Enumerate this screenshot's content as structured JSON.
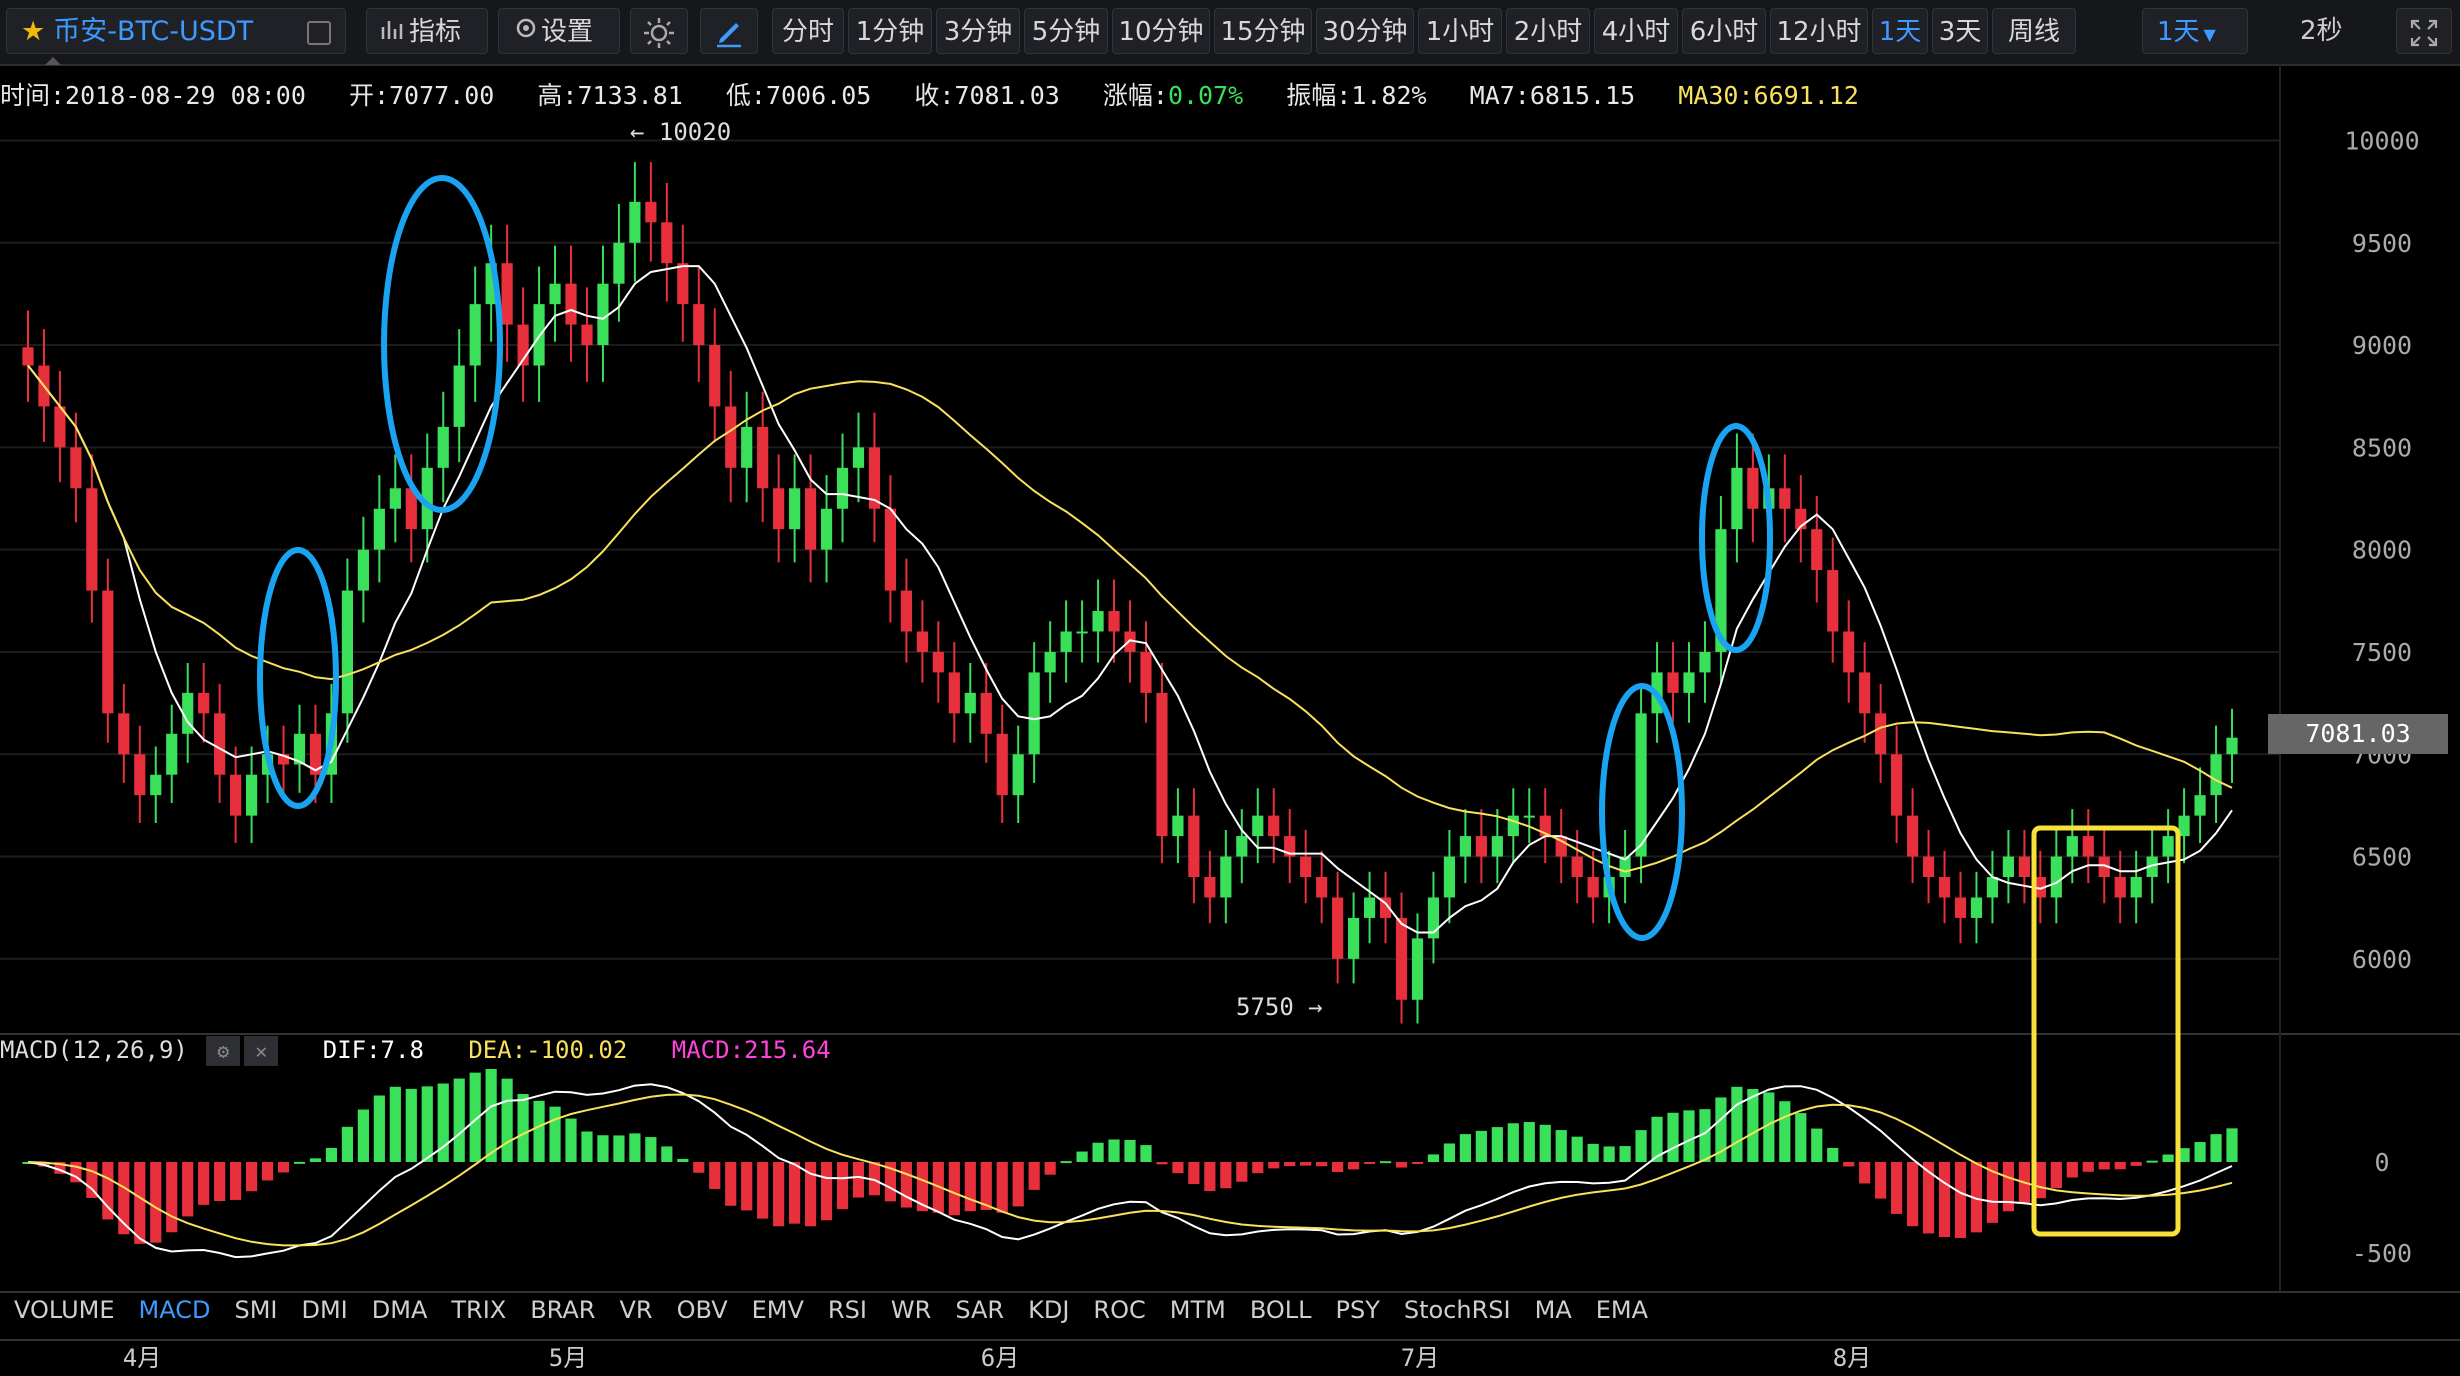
{
  "toolbar": {
    "symbol": "币安-BTC-USDT",
    "indicators": "指标",
    "settings": "设置",
    "intervals": [
      "分时",
      "1分钟",
      "3分钟",
      "5分钟",
      "10分钟",
      "15分钟",
      "30分钟",
      "1小时",
      "2小时",
      "4小时",
      "6小时",
      "12小时",
      "1天",
      "3天",
      "周线"
    ],
    "active_interval": "1天",
    "interval_dropdown": "1天",
    "refresh": "2秒"
  },
  "info": {
    "time": "时间:2018-08-29 08:00",
    "open": "开:7077.00",
    "high": "高:7133.81",
    "low": "低:7006.05",
    "close": "收:7081.03",
    "change_label": "涨幅:",
    "change_value": "0.07%",
    "amplitude": "振幅:1.82%",
    "ma7": "MA7:6815.15",
    "ma30": "MA30:6691.12"
  },
  "price_axis": {
    "ticks": [
      "10000",
      "9500",
      "9000",
      "8500",
      "8000",
      "7500",
      "7000",
      "6500",
      "6000"
    ],
    "current": "7081.03"
  },
  "annotations": {
    "high": "10020",
    "low": "5750"
  },
  "macd": {
    "title": "MACD(12,26,9)",
    "dif": "DIF:7.8",
    "dea": "DEA:-100.02",
    "macd": "MACD:215.64",
    "ticks": [
      "0",
      "-500"
    ]
  },
  "x_axis": {
    "labels": [
      "4月",
      "5月",
      "6月",
      "7月",
      "8月"
    ]
  },
  "indicator_tabs": [
    "VOLUME",
    "MACD",
    "SMI",
    "DMI",
    "DMA",
    "TRIX",
    "BRAR",
    "VR",
    "OBV",
    "EMV",
    "RSI",
    "WR",
    "SAR",
    "KDJ",
    "ROC",
    "MTM",
    "BOLL",
    "PSY",
    "StochRSI",
    "MA",
    "EMA"
  ],
  "active_indicator": "MACD",
  "colors": {
    "up": "#3ae05a",
    "down": "#e8303c",
    "ma7": "#ffffff",
    "ma30": "#f8e25c",
    "highlight_circle": "#1aa3f0",
    "highlight_box": "#f8e23a",
    "accent": "#3d9bff"
  },
  "chart_data": {
    "type": "candlestick",
    "y_range": [
      5750,
      10100
    ],
    "x_months": [
      "4月",
      "5月",
      "6月",
      "7月",
      "8月"
    ],
    "close_series": [
      8900,
      8700,
      8500,
      8300,
      7800,
      7200,
      7000,
      6800,
      6900,
      7100,
      7300,
      7200,
      6900,
      6700,
      6900,
      7000,
      6950,
      7100,
      6900,
      7200,
      7800,
      8000,
      8200,
      8300,
      8100,
      8400,
      8600,
      8900,
      9200,
      9400,
      9100,
      8900,
      9200,
      9300,
      9100,
      9000,
      9300,
      9500,
      9700,
      9600,
      9400,
      9200,
      9000,
      8700,
      8400,
      8600,
      8300,
      8100,
      8300,
      8000,
      8200,
      8400,
      8500,
      8200,
      7800,
      7600,
      7500,
      7400,
      7200,
      7300,
      7100,
      6800,
      7000,
      7400,
      7500,
      7600,
      7600,
      7700,
      7600,
      7500,
      7300,
      6600,
      6700,
      6400,
      6300,
      6500,
      6600,
      6700,
      6600,
      6500,
      6400,
      6300,
      6000,
      6200,
      6300,
      6200,
      5800,
      6100,
      6300,
      6500,
      6600,
      6500,
      6600,
      6700,
      6700,
      6600,
      6500,
      6400,
      6300,
      6400,
      6500,
      7200,
      7400,
      7300,
      7400,
      7500,
      8100,
      8400,
      8200,
      8300,
      8200,
      8100,
      7900,
      7600,
      7400,
      7200,
      7000,
      6700,
      6500,
      6400,
      6300,
      6200,
      6300,
      6400,
      6500,
      6400,
      6300,
      6500,
      6600,
      6500,
      6400,
      6300,
      6400,
      6500,
      6600,
      6700,
      6800,
      7000,
      7081
    ]
  }
}
